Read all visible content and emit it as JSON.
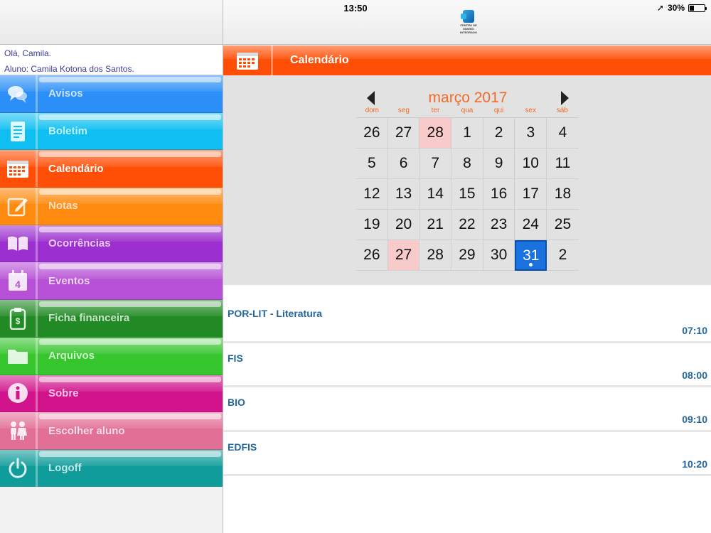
{
  "status_bar": {
    "time": "13:50",
    "battery": "30%",
    "battery_level": 0.3
  },
  "logo": {
    "text": "CENTRO DE ENSINO INTEGRADO"
  },
  "greeting": {
    "hello": "Olá, Camila.",
    "student": "Aluno: Camila Kotona dos Santos."
  },
  "menu": [
    {
      "label": "Avisos",
      "icon": "speech-bubbles-icon",
      "color": "#2b8ff7"
    },
    {
      "label": "Boletim",
      "icon": "document-icon",
      "color": "#0fbff2"
    },
    {
      "label": "Calendário",
      "icon": "calendar-icon",
      "color": "#ff4f07",
      "active": true
    },
    {
      "label": "Notas",
      "icon": "pencil-note-icon",
      "color": "#ff8a10"
    },
    {
      "label": "Ocorrências",
      "icon": "open-book-icon",
      "color": "#9b2fcf"
    },
    {
      "label": "Eventos",
      "icon": "calendar-day-icon",
      "color": "#b650d6"
    },
    {
      "label": "Ficha financeira",
      "icon": "money-clipboard-icon",
      "color": "#218a25"
    },
    {
      "label": "Arquivos",
      "icon": "folder-icon",
      "color": "#37c52e"
    },
    {
      "label": "Sobre",
      "icon": "info-icon",
      "color": "#d1148c"
    },
    {
      "label": "Escolher aluno",
      "icon": "children-icon",
      "color": "#e27096"
    },
    {
      "label": "Logoff",
      "icon": "power-icon",
      "color": "#0f9c9a"
    }
  ],
  "main": {
    "title": "Calendário",
    "title_icon": "calendar-icon"
  },
  "calendar": {
    "month_label": "março 2017",
    "weekdays": [
      "dom",
      "seg",
      "ter",
      "qua",
      "qui",
      "sex",
      "sáb"
    ],
    "days": [
      "26",
      "27",
      "28",
      "1",
      "2",
      "3",
      "4",
      "5",
      "6",
      "7",
      "8",
      "9",
      "10",
      "11",
      "12",
      "13",
      "14",
      "15",
      "16",
      "17",
      "18",
      "19",
      "20",
      "21",
      "22",
      "23",
      "24",
      "25",
      "26",
      "27",
      "28",
      "29",
      "30",
      "31",
      "2"
    ],
    "highlighted_indexes": [
      2,
      29
    ],
    "selected_index": 33
  },
  "events": [
    {
      "title": "POR-LIT - Literatura",
      "time": "07:10"
    },
    {
      "title": "FIS",
      "time": "08:00"
    },
    {
      "title": "BIO",
      "time": "09:10"
    },
    {
      "title": "EDFIS",
      "time": "10:20"
    }
  ]
}
